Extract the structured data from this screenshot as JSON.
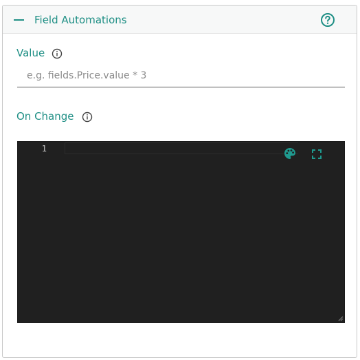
{
  "panel": {
    "title": "Field Automations",
    "collapse_icon": "minus-icon",
    "help_icon": "help-circle-icon"
  },
  "value_field": {
    "label": "Value",
    "info_icon": "info-icon",
    "placeholder": "e.g. fields.Price.value * 3",
    "value": ""
  },
  "on_change_field": {
    "label": "On Change",
    "info_icon": "info-icon"
  },
  "code_editor": {
    "line_numbers": [
      "1"
    ],
    "content": "",
    "theme_icon": "palette-icon",
    "fullscreen_icon": "fullscreen-icon"
  },
  "colors": {
    "accent": "#1f8f85",
    "editor_background": "#202020"
  }
}
